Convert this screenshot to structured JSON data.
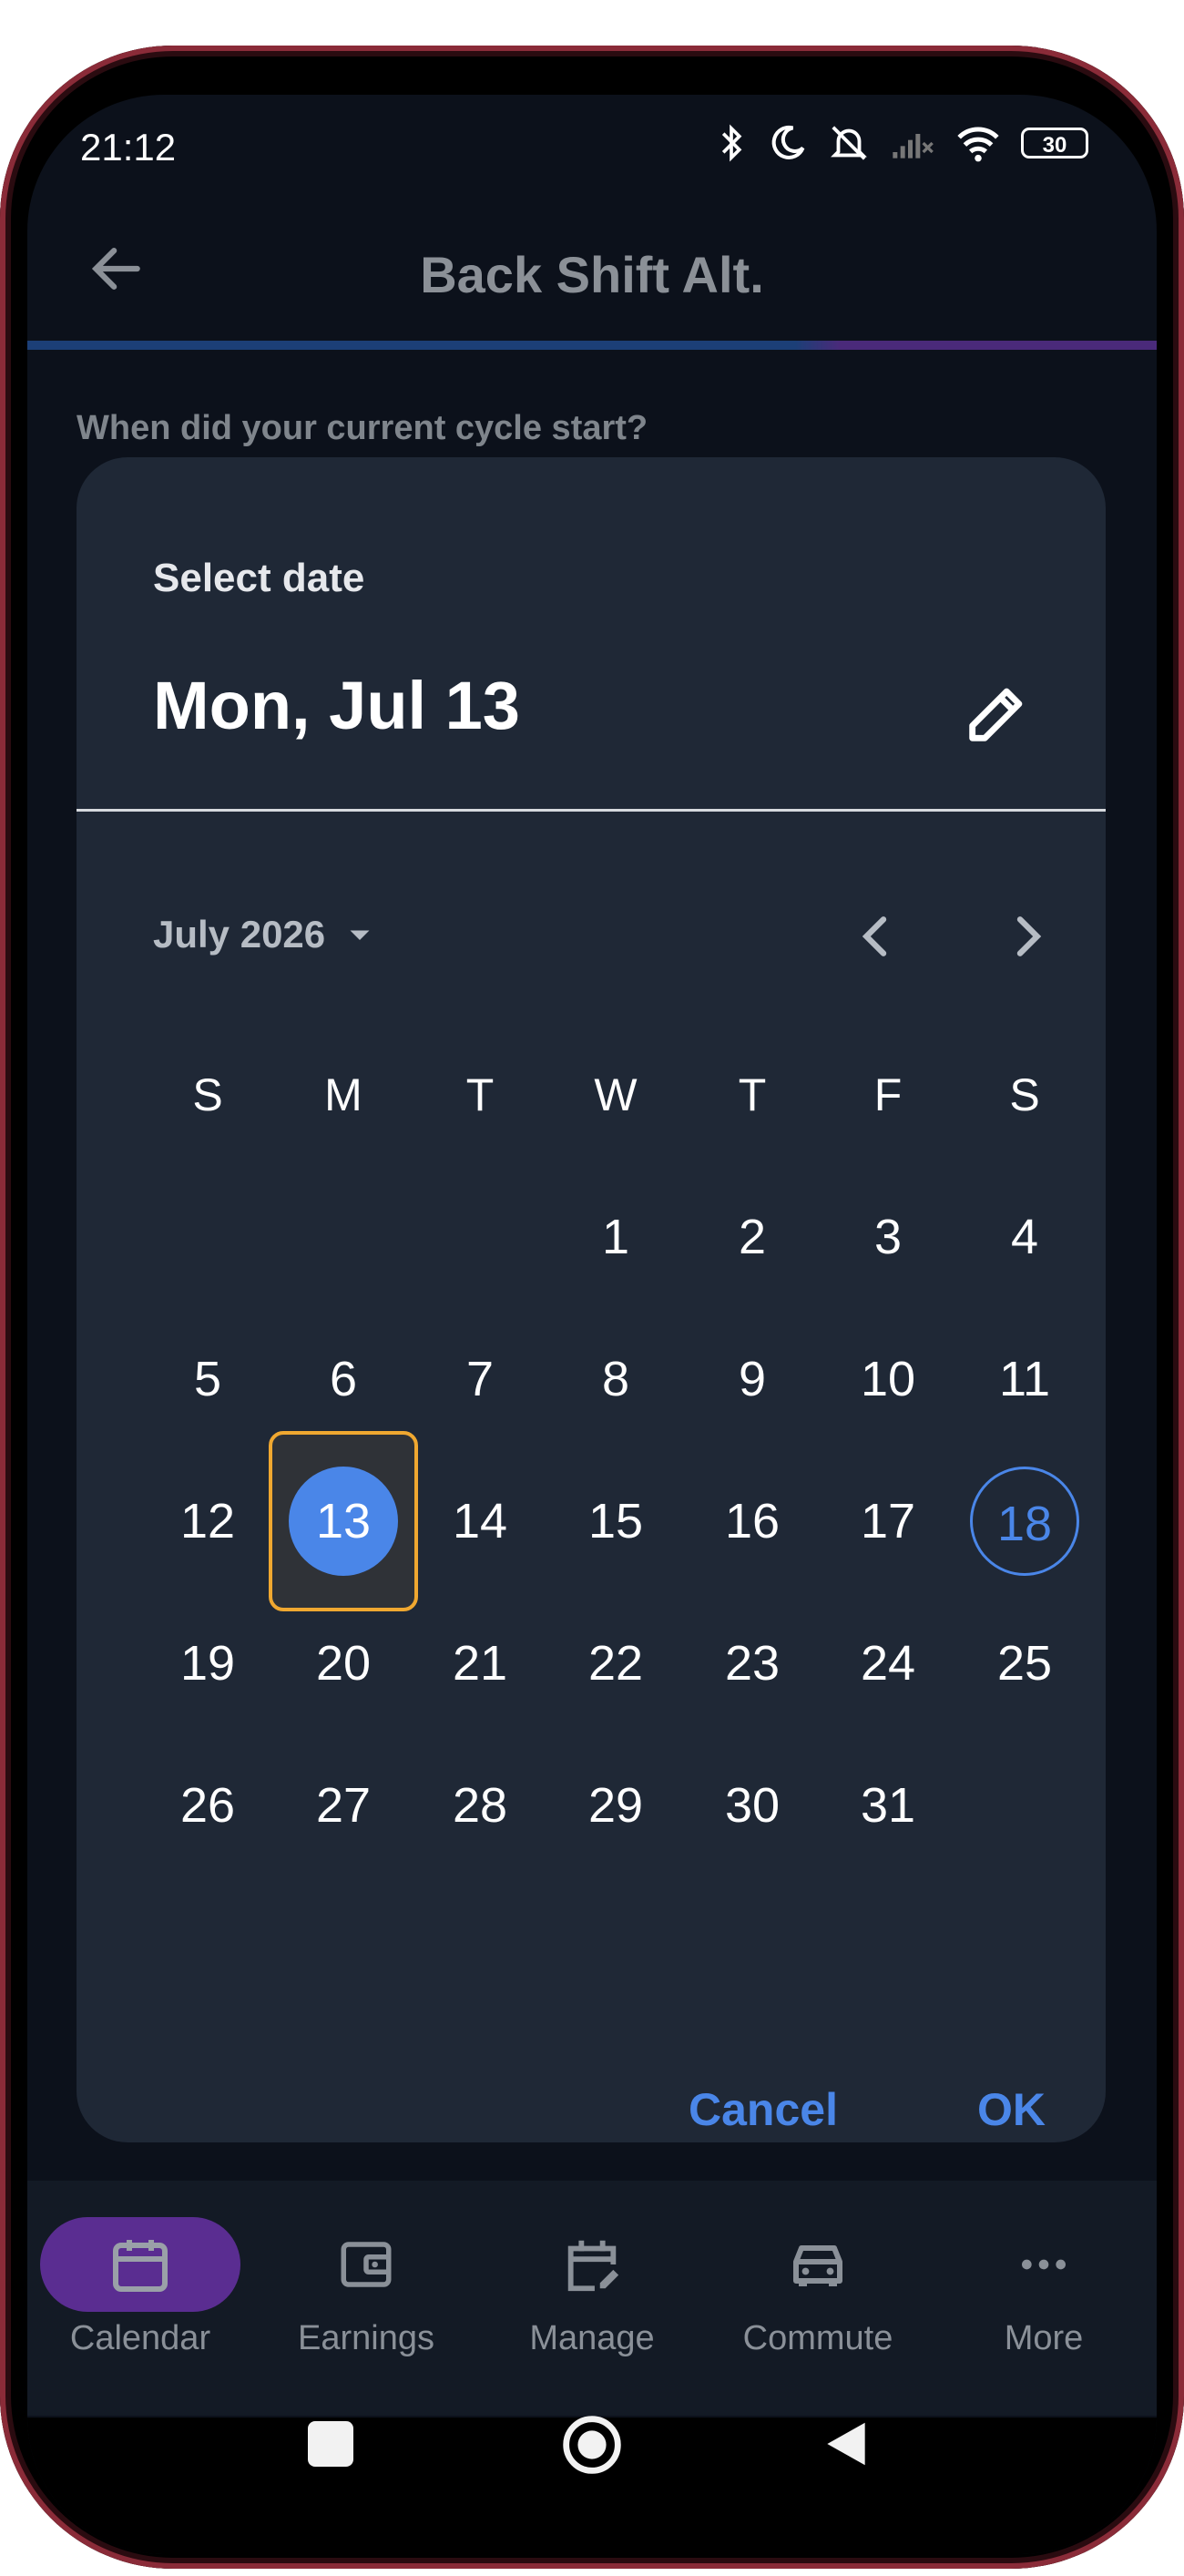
{
  "status_bar": {
    "time": "21:12",
    "battery": "30"
  },
  "app_bar": {
    "title": "Back Shift Alt."
  },
  "question": "When did your current cycle start?",
  "date_picker": {
    "header_label": "Select date",
    "selected_date": "Mon, Jul 13",
    "month_label": "July 2026",
    "weekdays": [
      "S",
      "M",
      "T",
      "W",
      "T",
      "F",
      "S"
    ],
    "days": [
      [
        "",
        "",
        "",
        "1",
        "2",
        "3",
        "4"
      ],
      [
        "5",
        "6",
        "7",
        "8",
        "9",
        "10",
        "11"
      ],
      [
        "12",
        "13",
        "14",
        "15",
        "16",
        "17",
        "18"
      ],
      [
        "19",
        "20",
        "21",
        "22",
        "23",
        "24",
        "25"
      ],
      [
        "26",
        "27",
        "28",
        "29",
        "30",
        "31",
        ""
      ]
    ],
    "selected_day": "13",
    "today": "18",
    "cancel_label": "Cancel",
    "ok_label": "OK"
  },
  "bottom_nav": [
    {
      "label": "Calendar",
      "icon": "calendar-icon",
      "active": true
    },
    {
      "label": "Earnings",
      "icon": "wallet-icon",
      "active": false
    },
    {
      "label": "Manage",
      "icon": "calendar-edit-icon",
      "active": false
    },
    {
      "label": "Commute",
      "icon": "car-icon",
      "active": false
    },
    {
      "label": "More",
      "icon": "more-dots-icon",
      "active": false
    }
  ],
  "colors": {
    "accent": "#4a86e8",
    "focus": "#f0a830",
    "nav_active": "#5a2d91"
  }
}
